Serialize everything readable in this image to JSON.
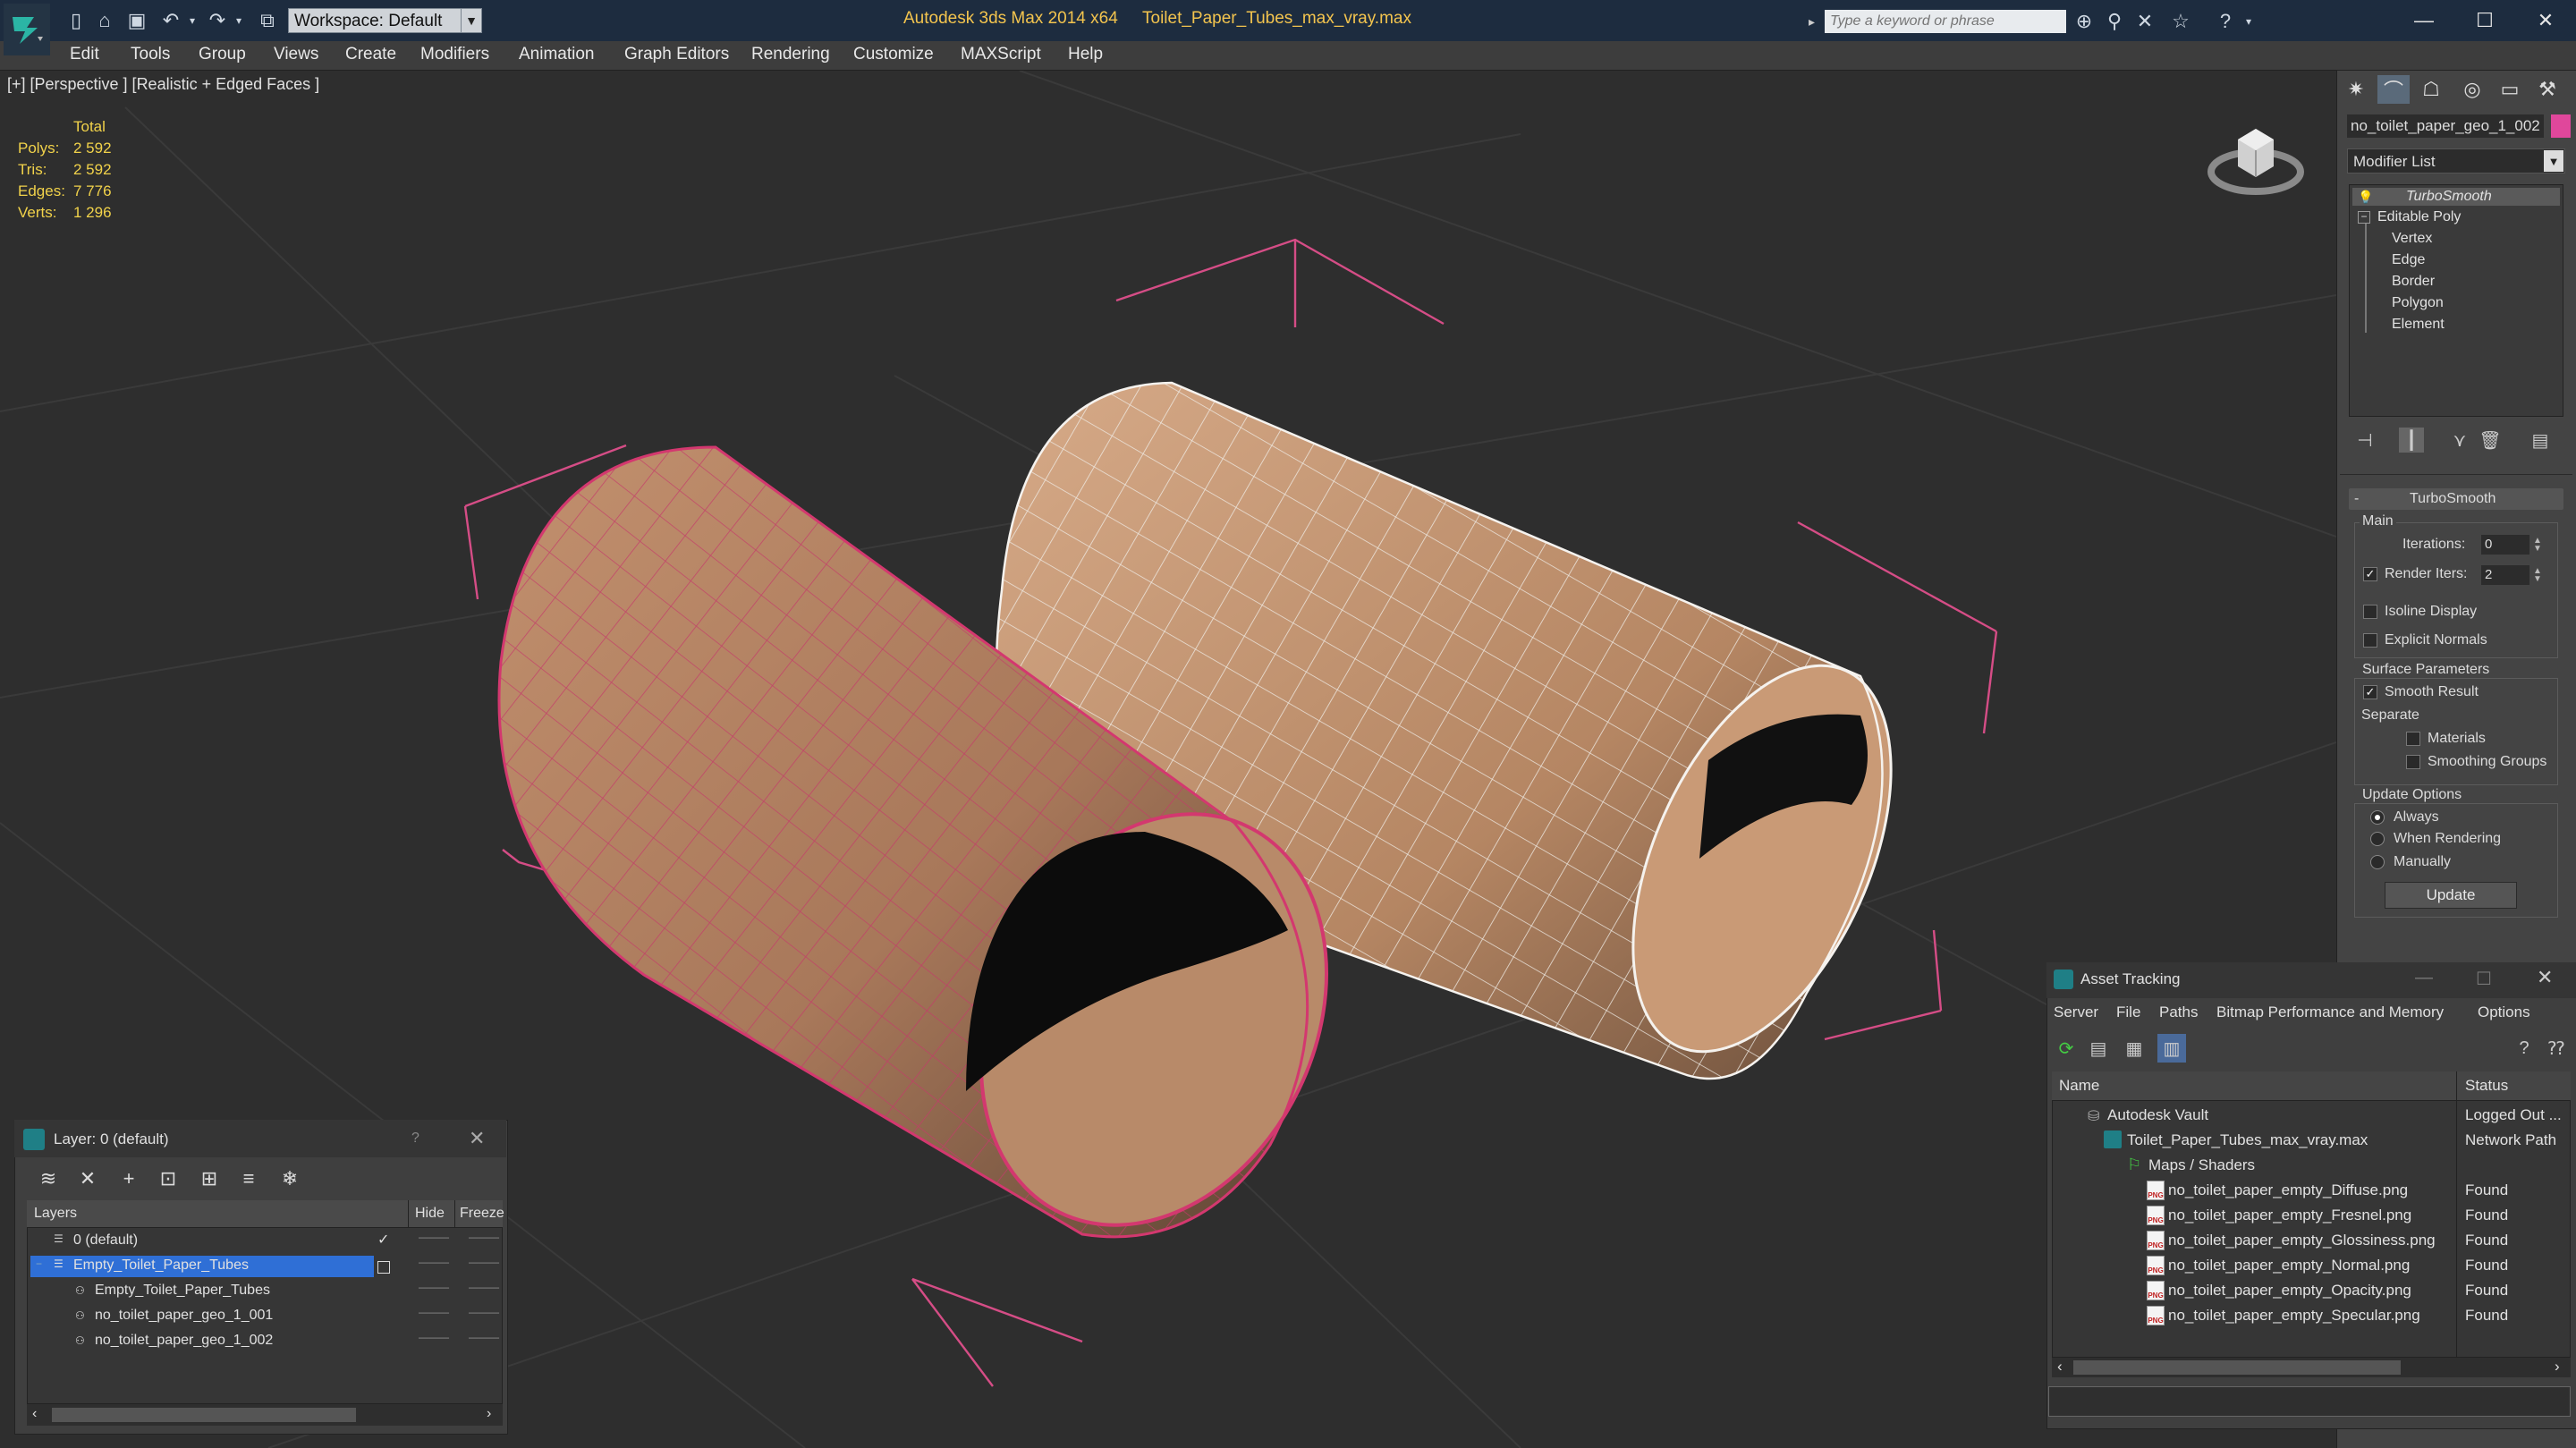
{
  "titlebar": {
    "workspace_label": "Workspace: Default",
    "app_title": "Autodesk 3ds Max  2014 x64",
    "file_title": "Toilet_Paper_Tubes_max_vray.max",
    "search_placeholder": "Type a keyword or phrase"
  },
  "menu": [
    "Edit",
    "Tools",
    "Group",
    "Views",
    "Create",
    "Modifiers",
    "Animation",
    "Graph Editors",
    "Rendering",
    "Customize",
    "MAXScript",
    "Help"
  ],
  "viewport": {
    "label": "[+] [Perspective ] [Realistic + Edged Faces ]",
    "stats": {
      "header": "Total",
      "rows": [
        {
          "k": "Polys:",
          "v": "2 592"
        },
        {
          "k": "Tris:",
          "v": "2 592"
        },
        {
          "k": "Edges:",
          "v": "7 776"
        },
        {
          "k": "Verts:",
          "v": "1 296"
        }
      ]
    }
  },
  "command_panel": {
    "object_name": "no_toilet_paper_geo_1_002",
    "object_color": "#e0479b",
    "modifier_list": "Modifier List",
    "stack": {
      "top": "TurboSmooth",
      "base": "Editable Poly",
      "subs": [
        "Vertex",
        "Edge",
        "Border",
        "Polygon",
        "Element"
      ]
    },
    "turbosmooth": {
      "title": "TurboSmooth",
      "main": "Main",
      "iterations_label": "Iterations:",
      "iterations_value": "0",
      "render_iters_label": "Render Iters:",
      "render_iters_value": "2",
      "isoline": "Isoline Display",
      "explicit_normals": "Explicit Normals",
      "surface_params": "Surface Parameters",
      "smooth_result": "Smooth Result",
      "separate": "Separate",
      "materials": "Materials",
      "smoothing_groups": "Smoothing Groups",
      "update_options": "Update Options",
      "always": "Always",
      "when_rendering": "When Rendering",
      "manually": "Manually",
      "update_button": "Update"
    }
  },
  "layer_panel": {
    "title": "Layer: 0 (default)",
    "help": "?",
    "col_layers": "Layers",
    "col_hide": "Hide",
    "col_freeze": "Freeze",
    "rows": [
      {
        "name": "0 (default)"
      },
      {
        "name": "Empty_Toilet_Paper_Tubes"
      },
      {
        "name": "Empty_Toilet_Paper_Tubes"
      },
      {
        "name": "no_toilet_paper_geo_1_001"
      },
      {
        "name": "no_toilet_paper_geo_1_002"
      }
    ]
  },
  "asset_tracking": {
    "title": "Asset Tracking",
    "menu": [
      "Server",
      "File",
      "Paths",
      "Bitmap Performance and Memory",
      "Options"
    ],
    "col_name": "Name",
    "col_status": "Status",
    "rows": [
      {
        "name": "Autodesk Vault",
        "status": "Logged Out ..."
      },
      {
        "name": "Toilet_Paper_Tubes_max_vray.max",
        "status": "Network Path"
      },
      {
        "name": "Maps / Shaders",
        "status": ""
      },
      {
        "name": "no_toilet_paper_empty_Diffuse.png",
        "status": "Found"
      },
      {
        "name": "no_toilet_paper_empty_Fresnel.png",
        "status": "Found"
      },
      {
        "name": "no_toilet_paper_empty_Glossiness.png",
        "status": "Found"
      },
      {
        "name": "no_toilet_paper_empty_Normal.png",
        "status": "Found"
      },
      {
        "name": "no_toilet_paper_empty_Opacity.png",
        "status": "Found"
      },
      {
        "name": "no_toilet_paper_empty_Specular.png",
        "status": "Found"
      }
    ]
  }
}
